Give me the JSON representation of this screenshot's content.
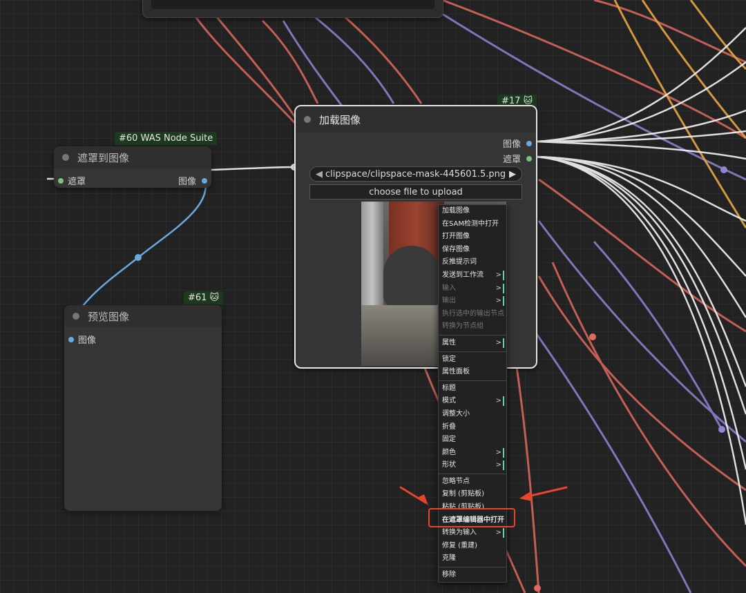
{
  "nodes": {
    "mask_to_image": {
      "badge": "#60 WAS Node Suite",
      "title": "遮罩到图像",
      "input_label": "遮罩",
      "output_label": "图像"
    },
    "preview_image": {
      "badge": "#61 🐱",
      "title": "预览图像",
      "input_label": "图像"
    },
    "load_image": {
      "badge": "#17 🐱",
      "title": "加载图像",
      "output_image_label": "图像",
      "output_mask_label": "遮罩",
      "file_widget_value": "clipspace/clipspace-mask-445601.5.png [input]",
      "upload_button_label": "choose file to upload"
    }
  },
  "context_menu": {
    "items": [
      {
        "label": "加载图像",
        "disabled": false,
        "submenu": false
      },
      {
        "label": "在SAM检测中打开",
        "disabled": false,
        "submenu": false
      },
      {
        "label": "打开图像",
        "disabled": false,
        "submenu": false
      },
      {
        "label": "保存图像",
        "disabled": false,
        "submenu": false
      },
      {
        "label": "反推提示词",
        "disabled": false,
        "submenu": false
      },
      {
        "label": "发送到工作流",
        "disabled": false,
        "submenu": true
      },
      {
        "label": "输入",
        "disabled": true,
        "submenu": true
      },
      {
        "label": "输出",
        "disabled": true,
        "submenu": true
      },
      {
        "label": "执行选中的输出节点",
        "disabled": true,
        "submenu": false
      },
      {
        "label": "转换为节点组",
        "disabled": true,
        "submenu": false
      },
      {
        "sep": true
      },
      {
        "label": "属性",
        "disabled": false,
        "submenu": true
      },
      {
        "sep": true
      },
      {
        "label": "锁定",
        "disabled": false,
        "submenu": false
      },
      {
        "label": "属性面板",
        "disabled": false,
        "submenu": false
      },
      {
        "sep": true
      },
      {
        "label": "标题",
        "disabled": false,
        "submenu": false
      },
      {
        "label": "模式",
        "disabled": false,
        "submenu": true
      },
      {
        "label": "调整大小",
        "disabled": false,
        "submenu": false
      },
      {
        "label": "折叠",
        "disabled": false,
        "submenu": false
      },
      {
        "label": "固定",
        "disabled": false,
        "submenu": false
      },
      {
        "label": "颜色",
        "disabled": false,
        "submenu": true
      },
      {
        "label": "形状",
        "disabled": false,
        "submenu": true
      },
      {
        "sep": true
      },
      {
        "label": "忽略节点",
        "disabled": false,
        "submenu": false
      },
      {
        "label": "复制 (剪贴板)",
        "disabled": false,
        "submenu": false
      },
      {
        "label": "粘贴 (剪贴板)",
        "disabled": false,
        "submenu": false
      },
      {
        "label": "在遮罩编辑器中打开",
        "disabled": false,
        "submenu": false,
        "highlighted": true
      },
      {
        "label": "转换为输入",
        "disabled": false,
        "submenu": true
      },
      {
        "label": "修复 (重建)",
        "disabled": false,
        "submenu": false
      },
      {
        "label": "克隆",
        "disabled": false,
        "submenu": false
      },
      {
        "sep": true
      },
      {
        "label": "移除",
        "disabled": false,
        "submenu": false
      }
    ],
    "submenu_glyph": ">"
  },
  "colors": {
    "link_red": "#e06a60",
    "link_purple": "#8f86d6",
    "link_orange": "#e8a545",
    "link_white": "#f0f0f0",
    "link_blue": "#6aa8e0",
    "annotation": "#e8452c",
    "image_slot": "#6aa8e0",
    "mask_slot": "#7fc27f"
  }
}
